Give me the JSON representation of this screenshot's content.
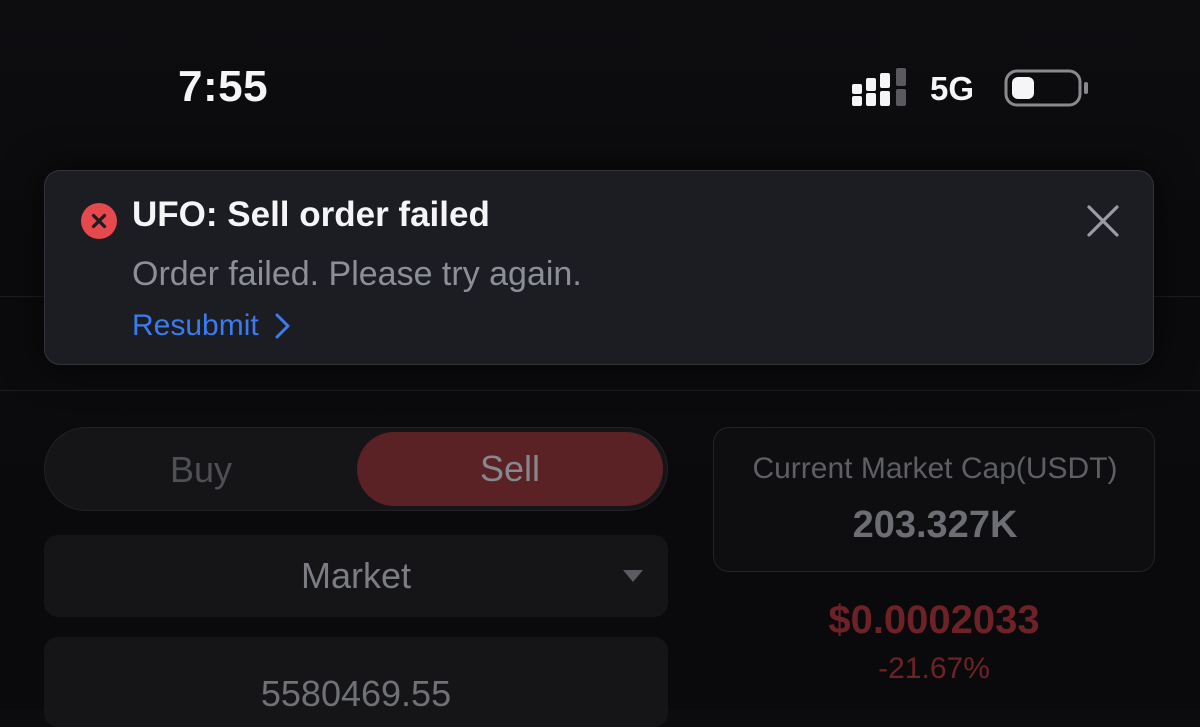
{
  "status_bar": {
    "time": "7:55",
    "network": "5G",
    "icons": [
      "signal-icon",
      "battery-icon"
    ]
  },
  "toast": {
    "icon": "error-icon",
    "title": "UFO: Sell order failed",
    "message": "Order failed. Please try again.",
    "action_label": "Resubmit",
    "close_icon": "close-icon",
    "colors": {
      "error": "#e5484d",
      "link": "#3b7bf0"
    }
  },
  "trade_form": {
    "side_switch": {
      "buy_label": "Buy",
      "sell_label": "Sell",
      "selected": "Sell"
    },
    "order_type": {
      "value": "Market"
    },
    "amount": {
      "value": "5580469.55"
    }
  },
  "market_info": {
    "market_cap_label": "Current Market Cap(USDT)",
    "market_cap_value": "203.327K",
    "price": "$0.0002033",
    "change": "-21.67%",
    "change_color": "#e5484d"
  }
}
